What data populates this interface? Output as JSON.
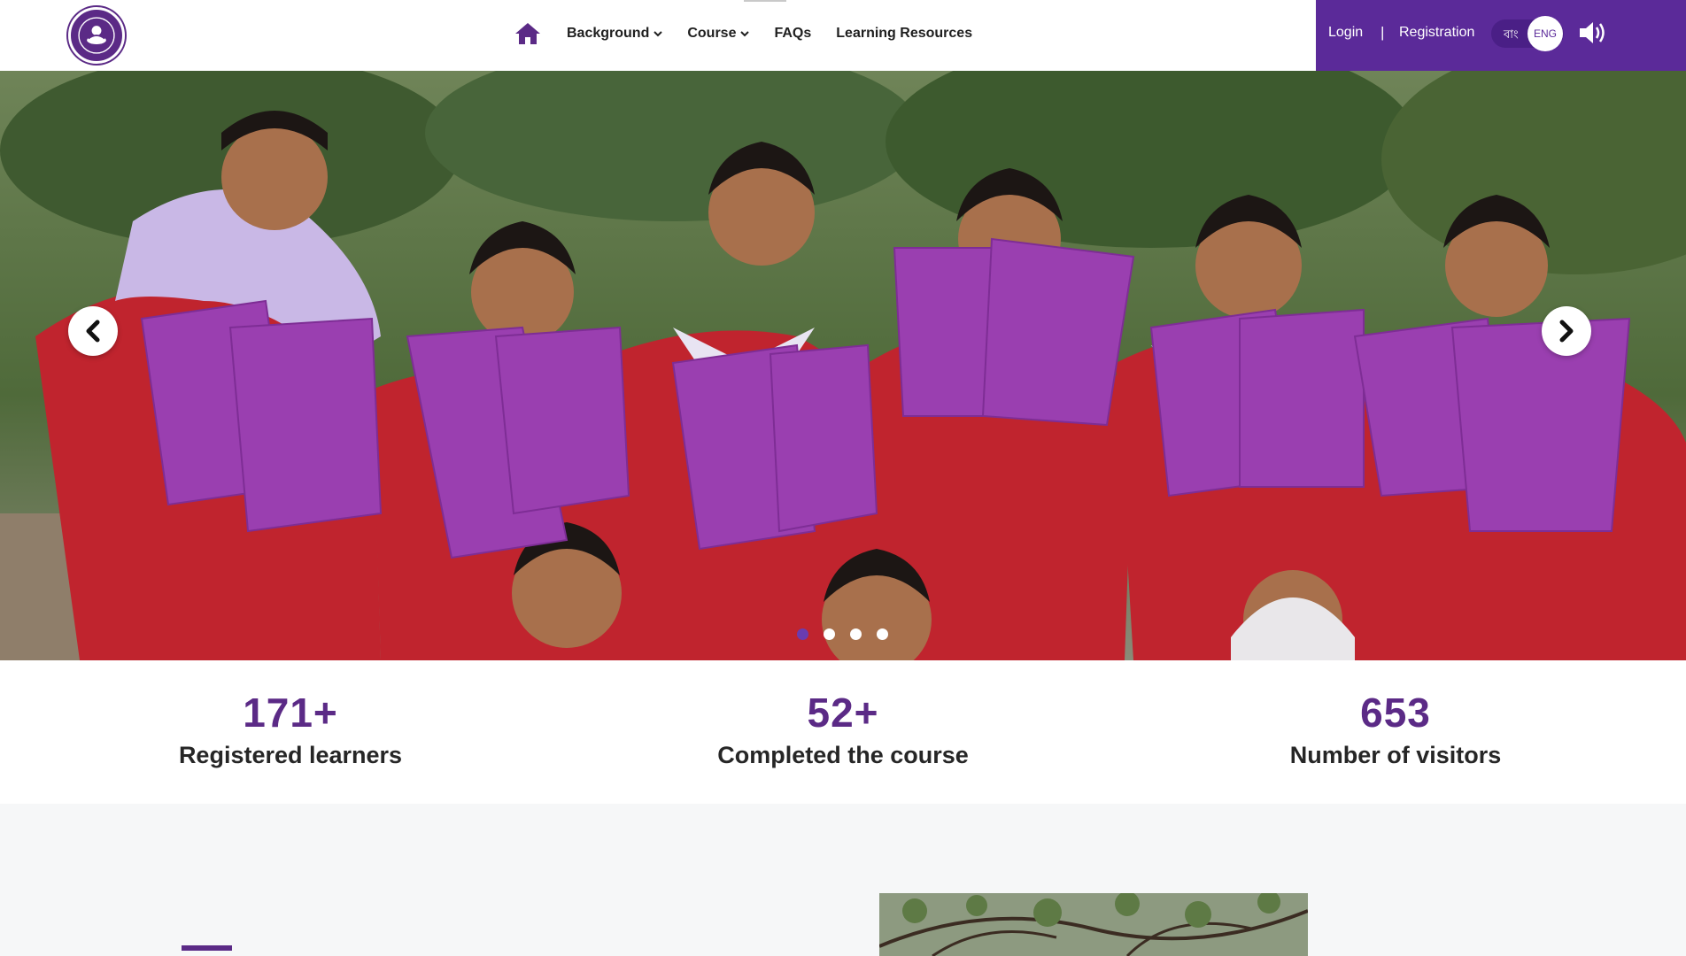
{
  "header": {
    "logo_name": "nutrition-challenge-logo",
    "nav": {
      "home_icon": "home-icon",
      "items": [
        {
          "label": "Background",
          "has_dropdown": true
        },
        {
          "label": "Course",
          "has_dropdown": true
        },
        {
          "label": "FAQs",
          "has_dropdown": false
        },
        {
          "label": "Learning Resources",
          "has_dropdown": false
        }
      ]
    },
    "auth": {
      "login_label": "Login",
      "separator": "|",
      "registration_label": "Registration"
    },
    "language": {
      "bn_label": "বাং",
      "en_label": "ENG",
      "selected": "ENG"
    },
    "speaker_icon": "speaker-icon",
    "accent_color": "#5b2a99"
  },
  "hero": {
    "prev_icon": "chevron-left-icon",
    "next_icon": "chevron-right-icon",
    "slide_count": 4,
    "active_slide": 1,
    "image_description_icon": "hero-photo"
  },
  "stats": [
    {
      "value": "171+",
      "label": "Registered learners"
    },
    {
      "value": "52+",
      "label": "Completed the course"
    },
    {
      "value": "653",
      "label": "Number of visitors"
    }
  ],
  "colors": {
    "brand_purple": "#5b2a86",
    "stat_text": "#262626"
  }
}
